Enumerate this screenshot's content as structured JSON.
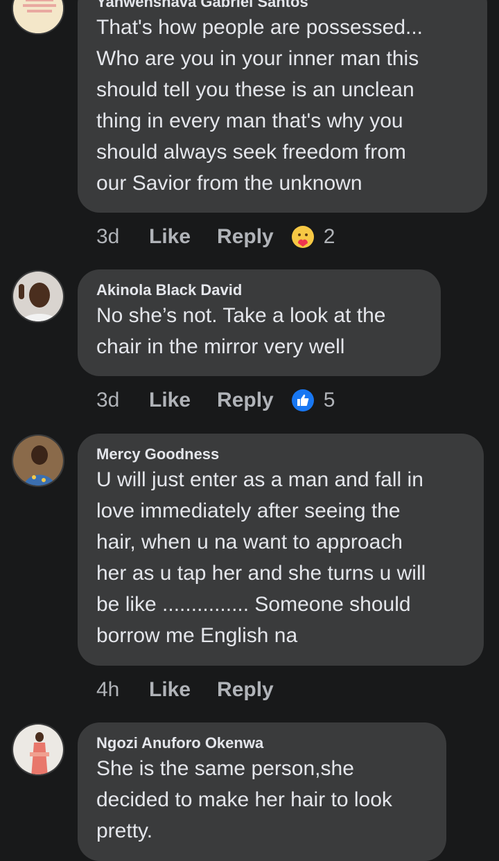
{
  "colors": {
    "background": "#18191a",
    "bubble": "#3a3b3c",
    "text": "#e4e6eb",
    "muted": "#b0b3b8",
    "like_blue": "#1877f2",
    "care_yellow": "#f7c844"
  },
  "comments": [
    {
      "author": "Yanwenshava Gabriel Santos",
      "text": "That's how people are possessed...\nWho are you in your inner man this\nshould tell you these is an unclean\nthing in every man that's why you\nshould always seek freedom from\nour Savior from the unknown",
      "time": "3d",
      "like": "Like",
      "reply": "Reply",
      "reaction": {
        "icon": "care-reaction-icon",
        "count": "2"
      }
    },
    {
      "author": "Akinola Black David",
      "text": "No she’s not. Take a look at the\nchair in the mirror very well",
      "time": "3d",
      "like": "Like",
      "reply": "Reply",
      "reaction": {
        "icon": "like-reaction-icon",
        "count": "5"
      }
    },
    {
      "author": "Mercy Goodness",
      "text": "U will just enter as a man and fall in\nlove immediately after seeing the\nhair, when u na want to approach\nher as u tap her and she turns u will\nbe like ............... Someone should\nborrow me English na",
      "time": "4h",
      "like": "Like",
      "reply": "Reply"
    },
    {
      "author": "Ngozi Anuforo Okenwa",
      "text": "She is the same person,she\ndecided to make her hair to look\npretty."
    }
  ]
}
